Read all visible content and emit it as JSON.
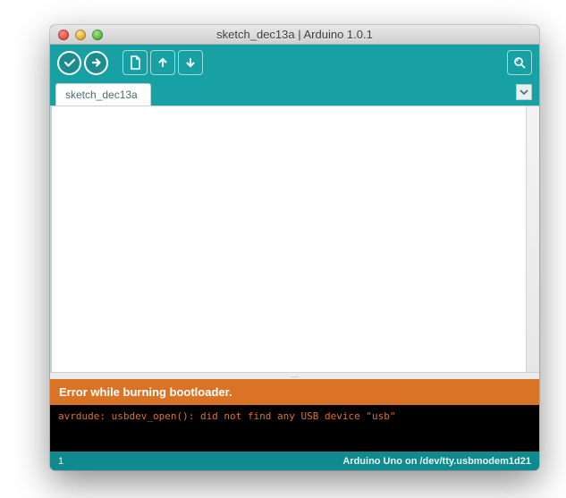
{
  "window": {
    "title": "sketch_dec13a | Arduino 1.0.1"
  },
  "toolbar": {
    "verify": "Verify",
    "upload": "Upload",
    "new": "New",
    "open": "Open",
    "save": "Save",
    "serial": "Serial Monitor"
  },
  "tabs": [
    {
      "label": "sketch_dec13a"
    }
  ],
  "editor": {
    "content": ""
  },
  "error": {
    "banner": "Error while burning bootloader."
  },
  "console": {
    "lines": [
      "avrdude: usbdev_open(): did not find any USB device \"usb\""
    ]
  },
  "status": {
    "line": "1",
    "board": "Arduino Uno on /dev/tty.usbmodem1d21"
  },
  "colors": {
    "teal": "#17a1a5",
    "tealDark": "#0f8a8e",
    "orange": "#d97427"
  }
}
